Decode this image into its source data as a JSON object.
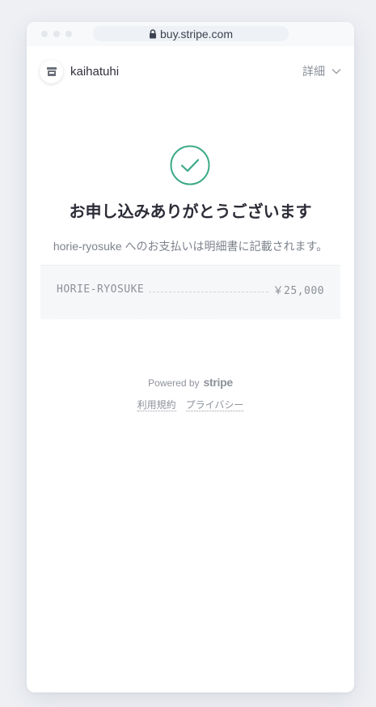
{
  "browser": {
    "url": "buy.stripe.com",
    "lock_icon": "lock-icon"
  },
  "header": {
    "merchant_name": "kaihatuhi",
    "avatar_icon": "store-icon",
    "details_label": "詳細",
    "details_icon": "chevron-down-icon"
  },
  "confirmation": {
    "icon": "checkmark-circle-icon",
    "title": "お申し込みありがとうございます",
    "subtext": "horie-ryosuke へのお支払いは明細書に記載されます。"
  },
  "receipt": {
    "descriptor": "HORIE-RYOSUKE",
    "amount": "￥25,000"
  },
  "footer": {
    "powered_by": "Powered by",
    "brand": "stripe",
    "terms_label": "利用規約",
    "privacy_label": "プライバシー"
  },
  "colors": {
    "success": "#3aa987",
    "background": "#eef0f4",
    "text_primary": "#2b2c36",
    "text_muted": "#8e929a"
  }
}
